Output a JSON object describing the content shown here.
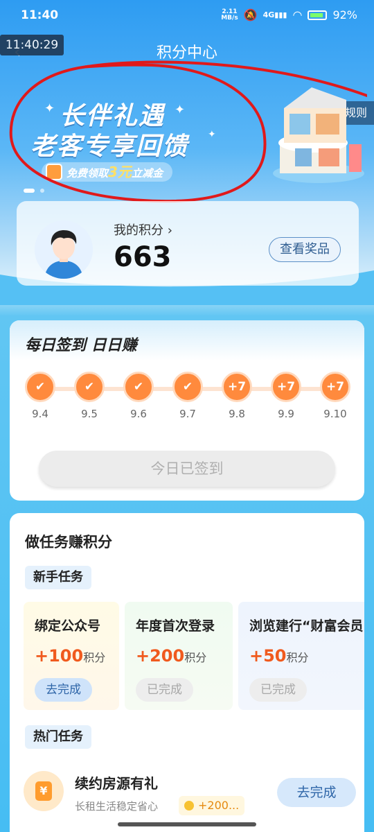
{
  "status_bar": {
    "time": "11:40",
    "net_speed_top": "2.11",
    "net_speed_bottom": "MB/s",
    "signal": "4G",
    "battery": "92%"
  },
  "overlay_time": "11:40:29",
  "header": {
    "title": "积分中心",
    "rules_label": "积分规则"
  },
  "banner": {
    "line1": "长伴礼遇",
    "line2": "老客专享回馈",
    "sub_prefix": "免费领取",
    "sub_amount": "3元",
    "sub_suffix": "立减金"
  },
  "points": {
    "label": "我的积分 ›",
    "value": "663",
    "prize_button": "查看奖品"
  },
  "signin": {
    "title": "每日签到 日日赚",
    "days": [
      {
        "date": "9.4",
        "mark": "✔",
        "signed": true
      },
      {
        "date": "9.5",
        "mark": "✔",
        "signed": true
      },
      {
        "date": "9.6",
        "mark": "✔",
        "signed": true
      },
      {
        "date": "9.7",
        "mark": "✔",
        "signed": true
      },
      {
        "date": "9.8",
        "mark": "+7",
        "signed": false
      },
      {
        "date": "9.9",
        "mark": "+7",
        "signed": false
      },
      {
        "date": "9.10",
        "mark": "+7",
        "signed": false
      }
    ],
    "button": "今日已签到"
  },
  "tasks": {
    "title": "做任务赚积分",
    "newbie_tag": "新手任务",
    "newbie": [
      {
        "name": "绑定公众号",
        "points": "+100",
        "unit": "积分",
        "button": "去完成",
        "done": false
      },
      {
        "name": "年度首次登录",
        "points": "+200",
        "unit": "积分",
        "button": "已完成",
        "done": true
      },
      {
        "name": "浏览建行“财富会员",
        "points": "+50",
        "unit": "积分",
        "button": "已完成",
        "done": true
      }
    ],
    "hot_tag": "热门任务",
    "hot": [
      {
        "name": "续约房源有礼",
        "desc": "长租生活稳定省心",
        "points": "+200...",
        "button": "去完成"
      }
    ]
  }
}
